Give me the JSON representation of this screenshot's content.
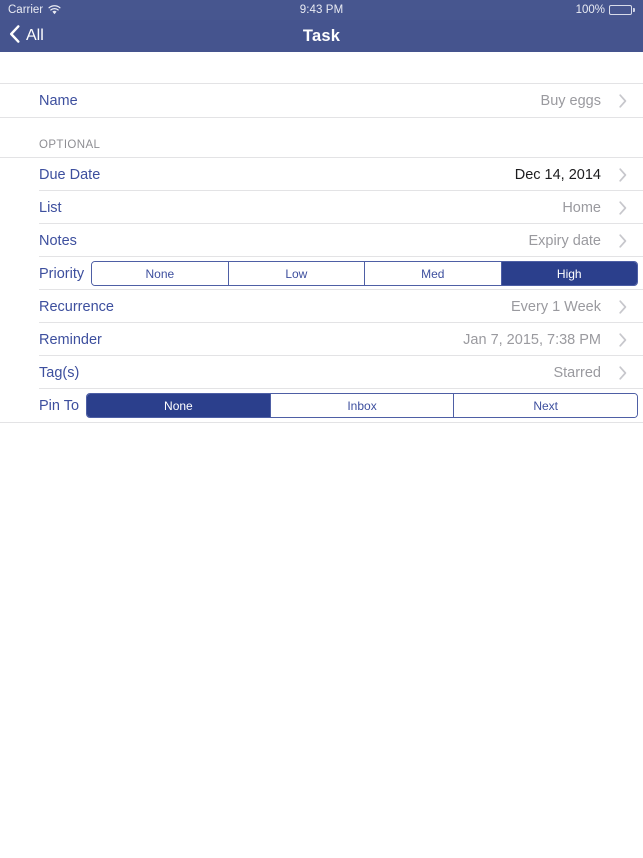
{
  "status_bar": {
    "carrier": "Carrier",
    "wifi_icon": "wifi-icon",
    "time": "9:43 PM",
    "battery_percent": "100%",
    "battery_icon": "battery-full-icon"
  },
  "nav_bar": {
    "back_icon": "chevron-left-icon",
    "back_label": "All",
    "title": "Task"
  },
  "name_section": {
    "rows": [
      {
        "label": "Name",
        "value": "Buy eggs",
        "value_style": "muted",
        "accessory": "chevron-right-icon"
      }
    ]
  },
  "optional_section": {
    "header": "OPTIONAL",
    "rows": [
      {
        "label": "Due Date",
        "value": "Dec 14, 2014",
        "value_style": "dark",
        "accessory": "chevron-right-icon"
      },
      {
        "label": "List",
        "value": "Home",
        "value_style": "muted",
        "accessory": "chevron-right-icon"
      },
      {
        "label": "Notes",
        "value": "Expiry date",
        "value_style": "muted",
        "accessory": "chevron-right-icon"
      }
    ],
    "priority": {
      "label": "Priority",
      "options": [
        "None",
        "Low",
        "Med",
        "High"
      ],
      "selected": "High"
    },
    "rows2": [
      {
        "label": "Recurrence",
        "value": "Every 1 Week",
        "value_style": "muted",
        "accessory": "chevron-right-icon"
      },
      {
        "label": "Reminder",
        "value": "Jan 7, 2015, 7:38 PM",
        "value_style": "muted",
        "accessory": "chevron-right-icon"
      },
      {
        "label": "Tag(s)",
        "value": "Starred",
        "value_style": "muted",
        "accessory": "chevron-right-icon"
      }
    ],
    "pin_to": {
      "label": "Pin To",
      "options": [
        "None",
        "Inbox",
        "Next"
      ],
      "selected": "None"
    }
  },
  "colors": {
    "nav_bar": "#45548e",
    "status_bar": "#47568f",
    "label_blue": "#3d4f9e",
    "segment_selected": "#2b3f8c",
    "segment_border": "#4e5fa5",
    "value_muted": "#9a9a9f",
    "value_dark": "#1c1c1e",
    "separator": "#e3e3e5",
    "section_header": "#8e8e93"
  }
}
